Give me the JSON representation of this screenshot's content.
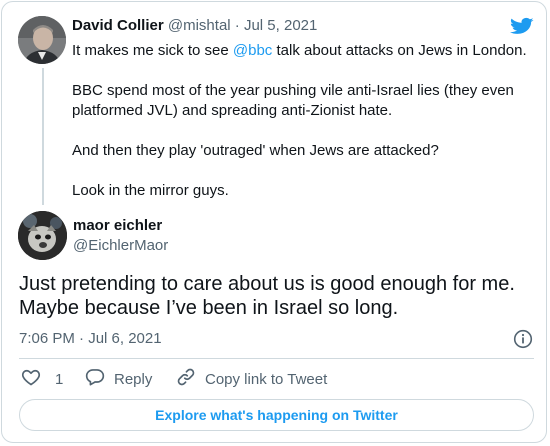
{
  "quoted_tweet": {
    "author_name": "David Collier",
    "handle": "@mishtal",
    "separator": "·",
    "date": "Jul 5, 2021",
    "text_prefix": "It makes me sick to see ",
    "mention": "@bbc",
    "text_suffix": " talk about attacks on Jews in London.",
    "paragraphs": [
      "BBC spend most of the year pushing vile anti-Israel lies (they even platformed JVL) and spreading anti-Zionist hate.",
      "And then they play 'outraged' when Jews are attacked?",
      "Look in the mirror guys."
    ]
  },
  "tweet": {
    "author_name": "maor eichler",
    "handle": "@EichlerMaor",
    "text": "Just pretending to care about us is good enough for me. Maybe because I’ve been in Israel so long.",
    "timestamp": "7:06 PM · Jul 6, 2021"
  },
  "actions": {
    "like_count": "1",
    "reply_label": "Reply",
    "copy_label": "Copy link to Tweet"
  },
  "footer": {
    "explore_label": "Explore what's happening on Twitter"
  },
  "icons": {
    "brand": "twitter-bird-icon",
    "info": "info-icon",
    "like": "heart-icon",
    "reply": "reply-icon",
    "copy": "link-icon"
  },
  "colors": {
    "accent": "#1d9bf0",
    "text": "#0f1419",
    "muted": "#536471",
    "border": "#cfd9de"
  }
}
